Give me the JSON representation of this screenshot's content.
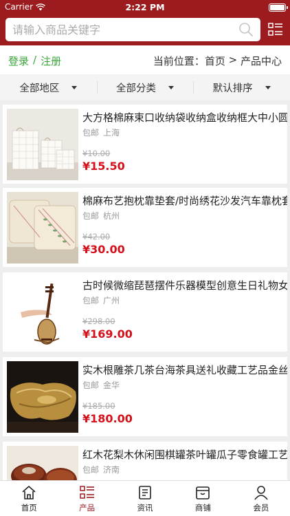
{
  "status_bar": {
    "carrier": "Carrier",
    "time": "2:22 PM"
  },
  "search": {
    "placeholder": "请输入商品关键字"
  },
  "breadcrumb": {
    "login": "登录",
    "separator": "/",
    "register": "注册",
    "location_label": "当前位置：",
    "home": "首页",
    "arrow": " > ",
    "current": "产品中心"
  },
  "filters": [
    {
      "label": "全部地区"
    },
    {
      "label": "全部分类"
    },
    {
      "label": "默认排序"
    }
  ],
  "products": [
    {
      "title": "大方格棉麻束口收纳袋收纳盒收纳框大中小圆",
      "shipping": "包邮",
      "location": "上海",
      "old_price": "¥10.00",
      "price": "¥15.50",
      "image": "fabric-storage-baskets"
    },
    {
      "title": "棉麻布艺抱枕靠垫套/时尚绣花沙发汽车靠枕套",
      "shipping": "包邮",
      "location": "杭州",
      "old_price": "¥42.00",
      "price": "¥30.00",
      "image": "embroidered-cushions"
    },
    {
      "title": "古时候微缩琵琶摆件乐器模型创意生日礼物女",
      "shipping": "包邮",
      "location": "广州",
      "old_price": "¥298.00",
      "price": "¥169.00",
      "image": "miniature-pipa"
    },
    {
      "title": "实木根雕茶几茶台海茶具送礼收藏工艺品金丝",
      "shipping": "包邮",
      "location": "金华",
      "old_price": "¥185.00",
      "price": "¥180.00",
      "image": "wood-root-tea-tray"
    },
    {
      "title": "红木花梨木休闲围棋罐茶叶罐瓜子零食罐工艺",
      "shipping": "包邮",
      "location": "济南",
      "old_price": "",
      "price": "",
      "image": "rosewood-jars"
    }
  ],
  "tabs": [
    {
      "label": "首页",
      "icon": "home-icon",
      "active": false
    },
    {
      "label": "产品",
      "icon": "list-icon",
      "active": true
    },
    {
      "label": "资讯",
      "icon": "news-icon",
      "active": false
    },
    {
      "label": "商铺",
      "icon": "shop-icon",
      "active": false
    },
    {
      "label": "会员",
      "icon": "user-icon",
      "active": false
    }
  ],
  "colors": {
    "brand": "#9c1b1f",
    "price": "#d4101a",
    "login": "#3aa43a"
  }
}
